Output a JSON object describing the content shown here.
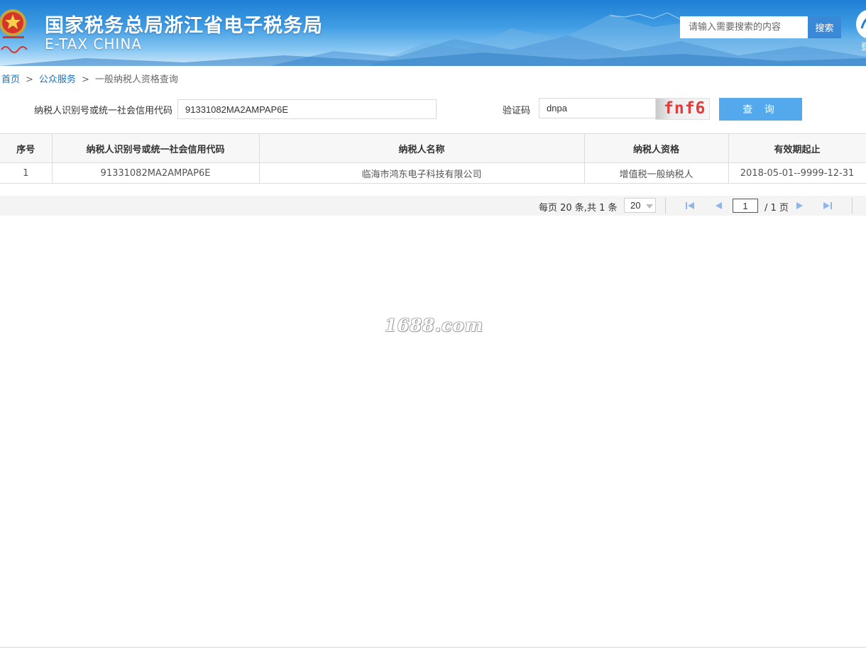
{
  "header": {
    "title_cn": "国家税务总局浙江省电子税务局",
    "title_en": "E-TAX CHINA",
    "search_placeholder": "请输入需要搜索的内容",
    "search_button": "搜索",
    "user_label": "登"
  },
  "breadcrumb": {
    "home": "首页",
    "separator": ">",
    "section": "公众服务",
    "current": "一般纳税人资格查询"
  },
  "form": {
    "taxpayer_id_label": "纳税人识别号或统一社会信用代码",
    "taxpayer_id_value": "91331082MA2AMPAP6E",
    "captcha_label": "验证码",
    "captcha_value": "dnpa",
    "captcha_image_text": "fnf6",
    "query_button": "查 询"
  },
  "table": {
    "headers": [
      "序号",
      "纳税人识别号或统一社会信用代码",
      "纳税人名称",
      "纳税人资格",
      "有效期起止"
    ],
    "rows": [
      [
        "1",
        "91331082MA2AMPAP6E",
        "临海市鸿东电子科技有限公司",
        "增值税一般纳税人",
        "2018-05-01--9999-12-31"
      ]
    ]
  },
  "pager": {
    "info": "每页 20 条,共 1 条",
    "page_size": "20",
    "current_page": "1",
    "total_pages": "/ 1 页"
  },
  "watermark": "1688.com",
  "colors": {
    "banner_blue": "#1f7fd4",
    "search_button": "#3a88d8",
    "query_button": "#53a9ec",
    "link": "#1a6fc0",
    "captcha_text": "#e33b3b"
  },
  "icons": [
    "emblem-icon",
    "first-page-icon",
    "prev-page-icon",
    "next-page-icon",
    "last-page-icon",
    "caret-down-icon",
    "user-icon"
  ]
}
